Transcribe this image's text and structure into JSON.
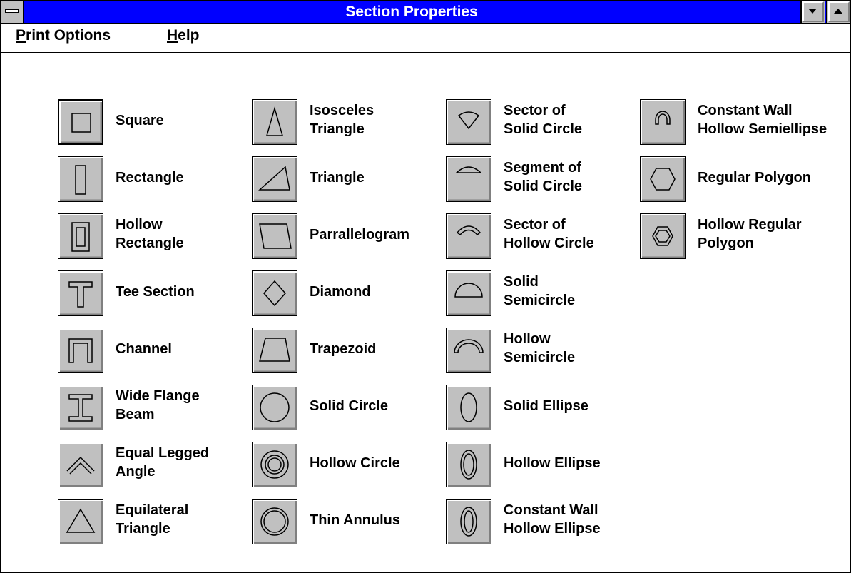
{
  "window": {
    "title": "Section Properties"
  },
  "menubar": {
    "print_options": {
      "accel": "P",
      "rest": "rint Options"
    },
    "help": {
      "accel": "H",
      "rest": "elp"
    }
  },
  "shapes": {
    "square": "Square",
    "rectangle": "Rectangle",
    "hollow_rectangle": "Hollow\nRectangle",
    "tee_section": "Tee Section",
    "channel": "Channel",
    "wide_flange_beam": "Wide Flange\nBeam",
    "equal_legged_angle": "Equal Legged\nAngle",
    "equilateral_triangle": "Equilateral\nTriangle",
    "isosceles_triangle": "Isosceles\nTriangle",
    "triangle": "Triangle",
    "parallelogram": "Parrallelogram",
    "diamond": "Diamond",
    "trapezoid": "Trapezoid",
    "solid_circle": "Solid Circle",
    "hollow_circle": "Hollow Circle",
    "thin_annulus": "Thin Annulus",
    "sector_solid_circle": "Sector of\nSolid Circle",
    "segment_solid_circle": "Segment of\nSolid Circle",
    "sector_hollow_circle": "Sector of\nHollow Circle",
    "solid_semicircle": "Solid\nSemicircle",
    "hollow_semicircle": "Hollow\nSemicircle",
    "solid_ellipse": "Solid Ellipse",
    "hollow_ellipse": "Hollow Ellipse",
    "constant_wall_hollow_ellipse": "Constant Wall\nHollow Ellipse",
    "constant_wall_hollow_semiellipse": "Constant Wall\nHollow Semiellipse",
    "regular_polygon": "Regular Polygon",
    "hollow_regular_polygon": "Hollow Regular\nPolygon"
  },
  "colors": {
    "titlebar": "#0000ff",
    "button_face": "#c0c0c0"
  }
}
